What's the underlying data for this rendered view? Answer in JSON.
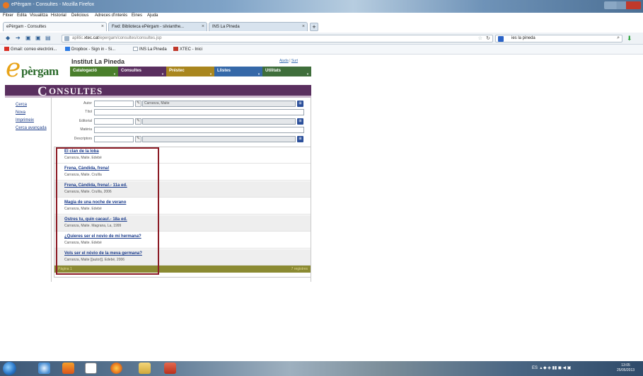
{
  "window": {
    "title": "ePèrgam - Consultes - Mozilla Firefox"
  },
  "menu": [
    "Fitxer",
    "Edita",
    "Visualitza",
    "Historial",
    "Delicious",
    "Adreces d'interès",
    "Eines",
    "Ajuda"
  ],
  "tabs": [
    {
      "label": "ePèrgam - Consultes",
      "active": true
    },
    {
      "label": "Fwd: Biblioteca ePèrgam - silvianthe...",
      "active": false
    },
    {
      "label": "INS La Pineda",
      "active": false
    }
  ],
  "newtab_label": "+",
  "address": {
    "url_prefix": "aplitic.",
    "url_host": "xtec.cat",
    "url_rest": "/epergam/consultes/consultes.jsp"
  },
  "search": {
    "value": "ies la pineda"
  },
  "bookmarks": [
    {
      "label": "Gmail: correo electróni...",
      "color": "#d93025"
    },
    {
      "label": "Dropbox - Sign in - Si...",
      "color": "#2c7be5"
    },
    {
      "label": "INS La Pineda",
      "color": "#9aa7b4"
    },
    {
      "label": "XTEC - Inici",
      "color": "#c0392b"
    }
  ],
  "site": {
    "logo_e": "e",
    "logo_rest": "pèrgam",
    "school": "Institut La Pineda",
    "toplinks": [
      "Ajuda",
      "Surt"
    ],
    "nav": [
      {
        "label": "Catalogació",
        "color": "#4a7f2c"
      },
      {
        "label": "Consultes",
        "color": "#5a2f5f"
      },
      {
        "label": "Préstec",
        "color": "#a9861e"
      },
      {
        "label": "Llistes",
        "color": "#3568a8"
      },
      {
        "label": "Utilitats",
        "color": "#3f6e3b"
      }
    ],
    "section_cap": "C",
    "section_rest": "ONSULTES"
  },
  "sidemenu": [
    "Cerca",
    "Nova",
    "Imprimeix",
    "Cerca avançada"
  ],
  "form": {
    "autor": {
      "label": "Autor",
      "value": "Carranza, Maite"
    },
    "titol": {
      "label": "Títol",
      "value": ""
    },
    "editorial": {
      "label": "Editorial",
      "value": ""
    },
    "materia": {
      "label": "Matèria",
      "value": ""
    },
    "descriptors": {
      "label": "Descriptors",
      "value": ""
    }
  },
  "results": [
    {
      "title": "El clan de la loba",
      "sub": "Carranza, Maite.  Edebé"
    },
    {
      "title": "Frena, Càndida, frena!",
      "sub": "Carranza, Maite.  Cruïlla"
    },
    {
      "title": "Frena, Càndida, frena!.- 11a ed.",
      "sub": "Carranza, Maite.  Cruïlla, 2006"
    },
    {
      "title": "Magia de una noche de verano",
      "sub": "Carranza, Maite.  Edebé"
    },
    {
      "title": "Ostres tu, quin cacau!.- 18a ed.",
      "sub": "Carranza, Maite.  Magrana, La, 1999"
    },
    {
      "title": "¿Quieres ser el novio de mi hermana?",
      "sub": "Carranza, Maite.  Edebé"
    },
    {
      "title": "Vols ser el nòvio de la meva germana?",
      "sub": "Carranza, Maite [[autor]].  Edebé, 2006"
    }
  ],
  "footer": {
    "page": "Pàgina 1",
    "count": "7 registres"
  },
  "taskbar": {
    "tray": "ES",
    "time": "13:05",
    "date": "25/05/2013"
  }
}
